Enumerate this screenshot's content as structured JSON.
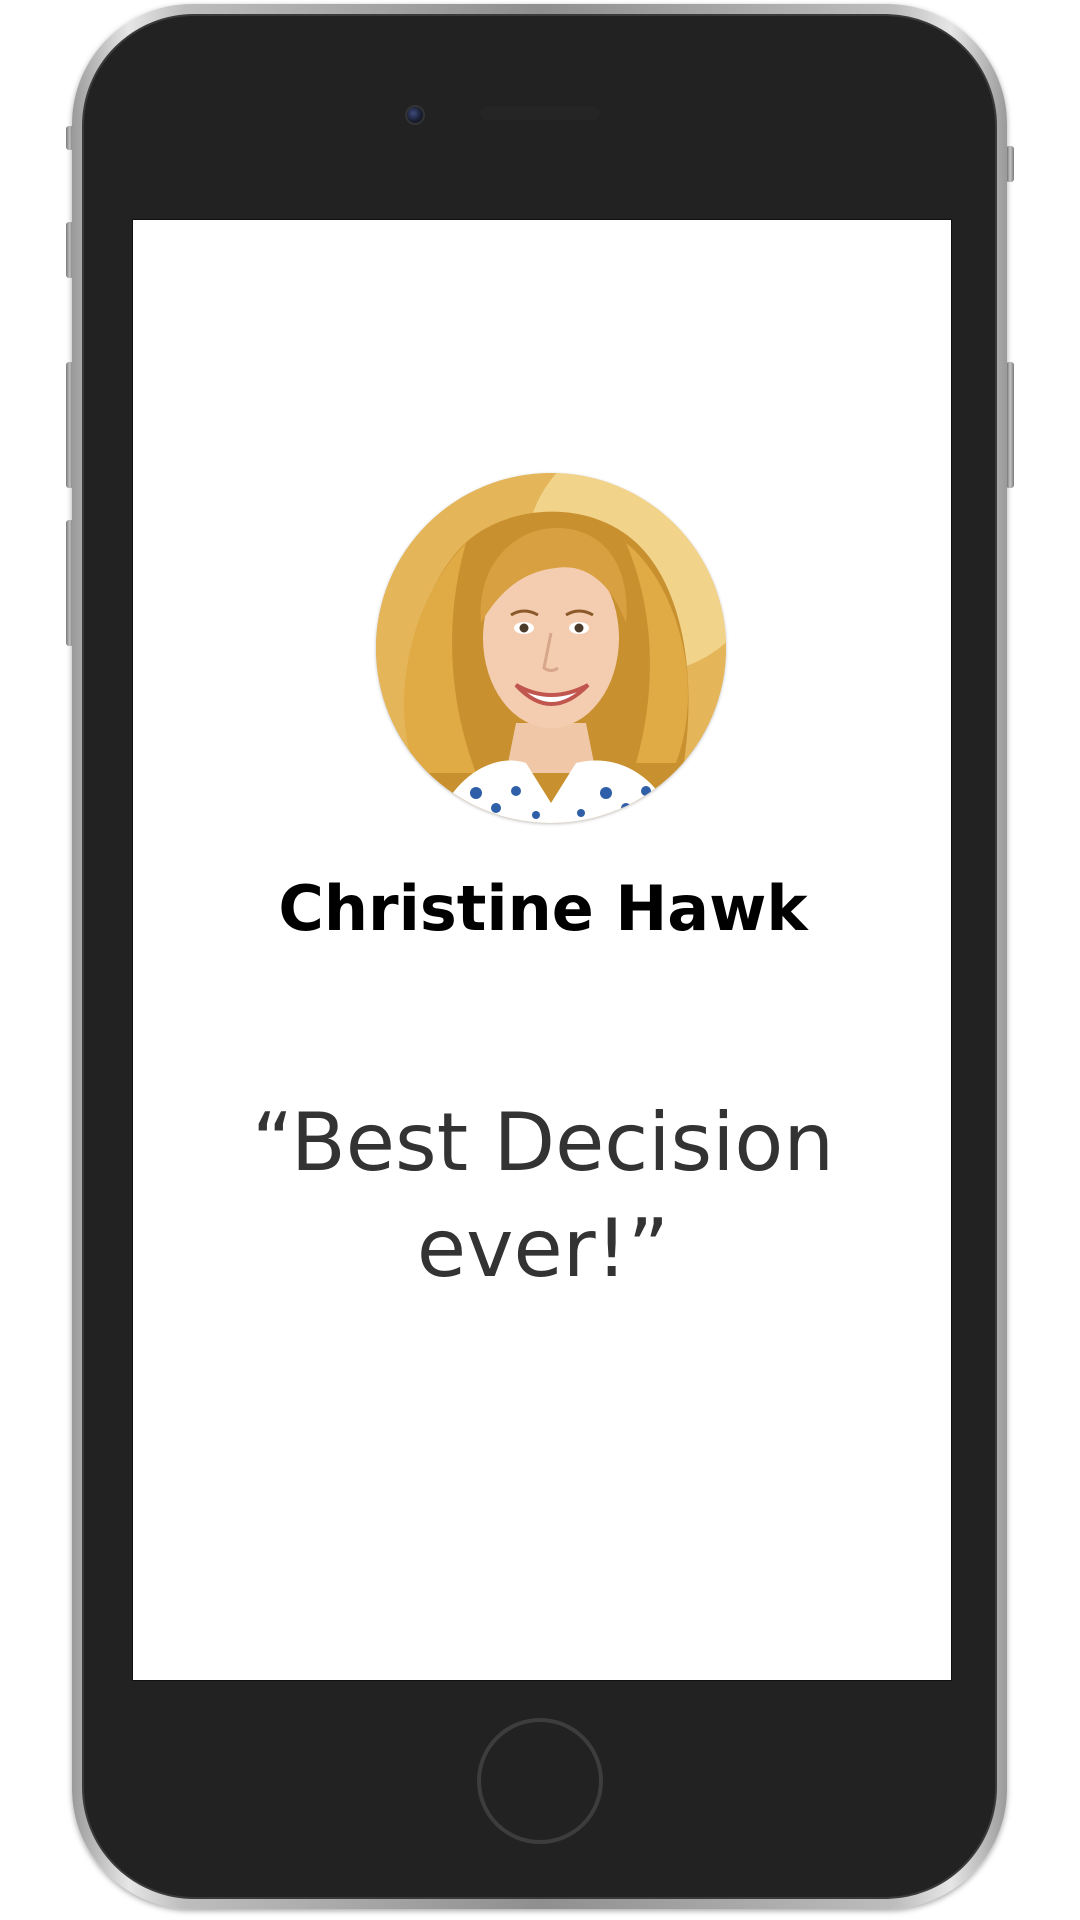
{
  "profile": {
    "name": "Christine Hawk",
    "quote": "“Best Decision ever!”",
    "avatar": {
      "icon": "avatar-photo"
    }
  },
  "device": {
    "frame_color": "#222222",
    "screen_color": "#ffffff"
  }
}
